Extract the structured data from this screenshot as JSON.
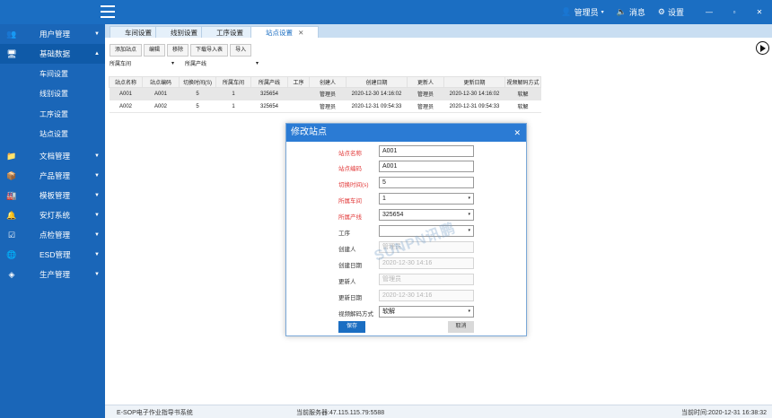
{
  "topbar": {
    "user_label": "管理员",
    "user_chev": "▾",
    "message_label": "消息",
    "settings_label": "设置",
    "win_min": "—",
    "win_restore": "▫",
    "win_close": "✕"
  },
  "sidebar": {
    "items": [
      {
        "label": "用户管理",
        "icon": "users-icon",
        "glyph": "👥"
      },
      {
        "label": "基础数据",
        "icon": "monitor-icon",
        "glyph": "🖥"
      },
      {
        "label": "文档管理",
        "icon": "folder-icon",
        "glyph": "📁"
      },
      {
        "label": "产品管理",
        "icon": "box-icon",
        "glyph": "📦"
      },
      {
        "label": "模板管理",
        "icon": "factory-icon",
        "glyph": "🏭"
      },
      {
        "label": "安灯系统",
        "icon": "bell-icon",
        "glyph": "🔔"
      },
      {
        "label": "点检管理",
        "icon": "checklist-icon",
        "glyph": "☑"
      },
      {
        "label": "ESD管理",
        "icon": "globe-icon",
        "glyph": "🌐"
      },
      {
        "label": "生产管理",
        "icon": "layers-icon",
        "glyph": "◈"
      }
    ],
    "subitems": [
      "车间设置",
      "线别设置",
      "工序设置",
      "站点设置"
    ],
    "chev_down": "▼",
    "chev_up": "▲"
  },
  "tabs": [
    "车间设置",
    "线别设置",
    "工序设置",
    "站点设置"
  ],
  "tab_close": "✕",
  "toolbar": {
    "add": "添加站点",
    "edit": "编辑",
    "delete": "移除",
    "template": "下载导入表",
    "import": "导入"
  },
  "filters": {
    "workshop_label": "所属车间",
    "workshop_value": "",
    "line_label": "所属产线",
    "line_value": "",
    "arrow": "▾"
  },
  "table": {
    "headers": [
      "站点名称",
      "站点编码",
      "切换时间(S)",
      "所属车间",
      "所属产线",
      "工序",
      "创建人",
      "创建日期",
      "更新人",
      "更新日期",
      "视频解码方式"
    ],
    "rows": [
      [
        "A001",
        "A001",
        "5",
        "1",
        "325654",
        "",
        "管理员",
        "2020-12-30 14:16:02",
        "管理员",
        "2020-12-30 14:16:02",
        "软解"
      ],
      [
        "A002",
        "A002",
        "5",
        "1",
        "325654",
        "",
        "管理员",
        "2020-12-31 09:54:33",
        "管理员",
        "2020-12-31 09:54:33",
        "软解"
      ]
    ]
  },
  "modal": {
    "title": "修改站点",
    "close": "✕",
    "fields": [
      {
        "label": "站点名称",
        "value": "A001"
      },
      {
        "label": "站点编码",
        "value": "A001"
      },
      {
        "label": "切换时间(s)",
        "value": "5"
      },
      {
        "label": "所属车间",
        "value": "1"
      },
      {
        "label": "所属产线",
        "value": "325654"
      },
      {
        "label": "工序",
        "value": ""
      },
      {
        "label": "创建人",
        "value": "管理员"
      },
      {
        "label": "创建日期",
        "value": "2020-12-30 14:16"
      },
      {
        "label": "更新人",
        "value": "管理员"
      },
      {
        "label": "更新日期",
        "value": "2020-12-30 14:16"
      },
      {
        "label": "视频解码方式",
        "value": "软解"
      }
    ],
    "arrow": "▾",
    "save": "保存",
    "cancel": "取消"
  },
  "watermark": "SUNPN讯鹏",
  "statusbar": {
    "system": "E-SOP电子作业指导书系统",
    "server": "当前服务器:47.115.115.79:5588",
    "time": "当前时间:2020-12-31 16:38:32"
  },
  "colors": {
    "primary": "#1b6ec2",
    "sidebar": "#1a66b8",
    "required": "#e23a3a"
  }
}
